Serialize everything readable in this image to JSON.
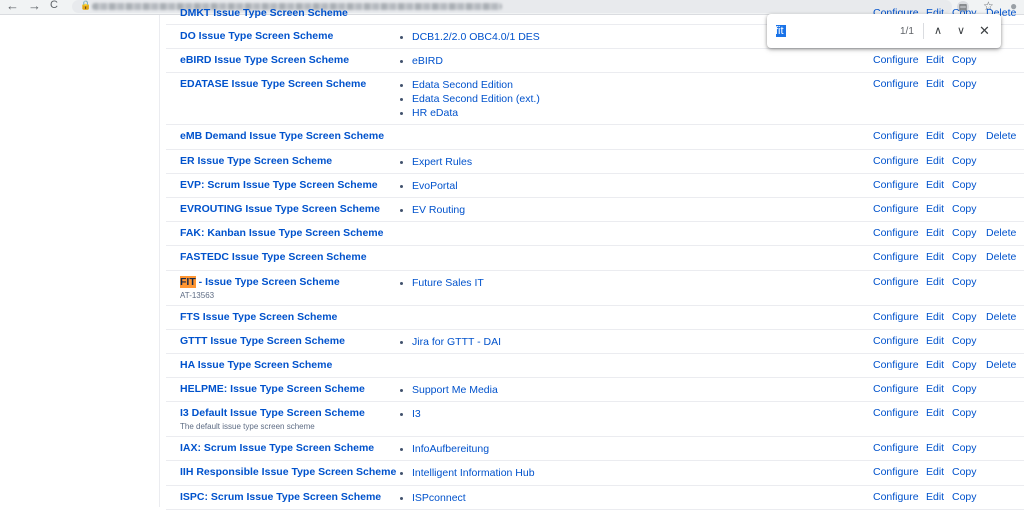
{
  "browser": {
    "back_icon": "←",
    "forward_icon": "→",
    "reload_icon": "C",
    "lock_icon": "🔒",
    "doc_icon": "▤",
    "star_icon": "☆",
    "account_icon": "●"
  },
  "findbar": {
    "query": "fit",
    "count": "1/1",
    "prev_icon": "∧",
    "next_icon": "∨",
    "close_icon": "✕"
  },
  "actions": {
    "configure": "Configure",
    "edit": "Edit",
    "copy": "Copy",
    "delete": "Delete"
  },
  "rows": [
    {
      "name": "DMKT Issue Type Screen Scheme",
      "description": "",
      "projects": [],
      "deletable": true
    },
    {
      "name": "DO Issue Type Screen Scheme",
      "description": "",
      "projects": [
        "DCB1.2/2.0 OBC4.0/1 DES"
      ],
      "deletable": false
    },
    {
      "name": "eBIRD Issue Type Screen Scheme",
      "description": "",
      "projects": [
        "eBIRD"
      ],
      "deletable": false
    },
    {
      "name": "EDATASE Issue Type Screen Scheme",
      "description": "",
      "projects": [
        "Edata Second Edition",
        "Edata Second Edition (ext.)",
        "HR eData"
      ],
      "deletable": false
    },
    {
      "name": "eMB Demand Issue Type Screen Scheme",
      "description": "",
      "projects": [],
      "deletable": true
    },
    {
      "name": "ER Issue Type Screen Scheme",
      "description": "",
      "projects": [
        "Expert Rules"
      ],
      "deletable": false
    },
    {
      "name": "EVP: Scrum Issue Type Screen Scheme",
      "description": "",
      "projects": [
        "EvoPortal"
      ],
      "deletable": false
    },
    {
      "name": "EVROUTING Issue Type Screen Scheme",
      "description": "",
      "projects": [
        "EV Routing"
      ],
      "deletable": false
    },
    {
      "name": "FAK: Kanban Issue Type Screen Scheme",
      "description": "",
      "projects": [],
      "deletable": true
    },
    {
      "name": "FASTEDC Issue Type Screen Scheme",
      "description": "",
      "projects": [],
      "deletable": true
    },
    {
      "name_prefix": "FIT",
      "name": " - Issue Type Screen Scheme",
      "description": "AT-13563",
      "projects": [
        "Future Sales IT"
      ],
      "deletable": false
    },
    {
      "name": "FTS Issue Type Screen Scheme",
      "description": "",
      "projects": [],
      "deletable": true
    },
    {
      "name": "GTTT Issue Type Screen Scheme",
      "description": "",
      "projects": [
        "Jira for GTTT - DAI"
      ],
      "deletable": false
    },
    {
      "name": "HA Issue Type Screen Scheme",
      "description": "",
      "projects": [],
      "deletable": true
    },
    {
      "name": "HELPME: Issue Type Screen Scheme",
      "description": "",
      "projects": [
        "Support Me Media"
      ],
      "deletable": false
    },
    {
      "name": "I3 Default Issue Type Screen Scheme",
      "description": "The default issue type screen scheme",
      "projects": [
        "I3"
      ],
      "deletable": false
    },
    {
      "name": "IAX: Scrum Issue Type Screen Scheme",
      "description": "",
      "projects": [
        "InfoAufbereitung"
      ],
      "deletable": false
    },
    {
      "name": "IIH Responsible Issue Type Screen Scheme",
      "description": "",
      "projects": [
        "Intelligent Information Hub"
      ],
      "deletable": false
    },
    {
      "name": "ISPC: Scrum Issue Type Screen Scheme",
      "description": "",
      "projects": [
        "ISPconnect"
      ],
      "deletable": false
    }
  ]
}
